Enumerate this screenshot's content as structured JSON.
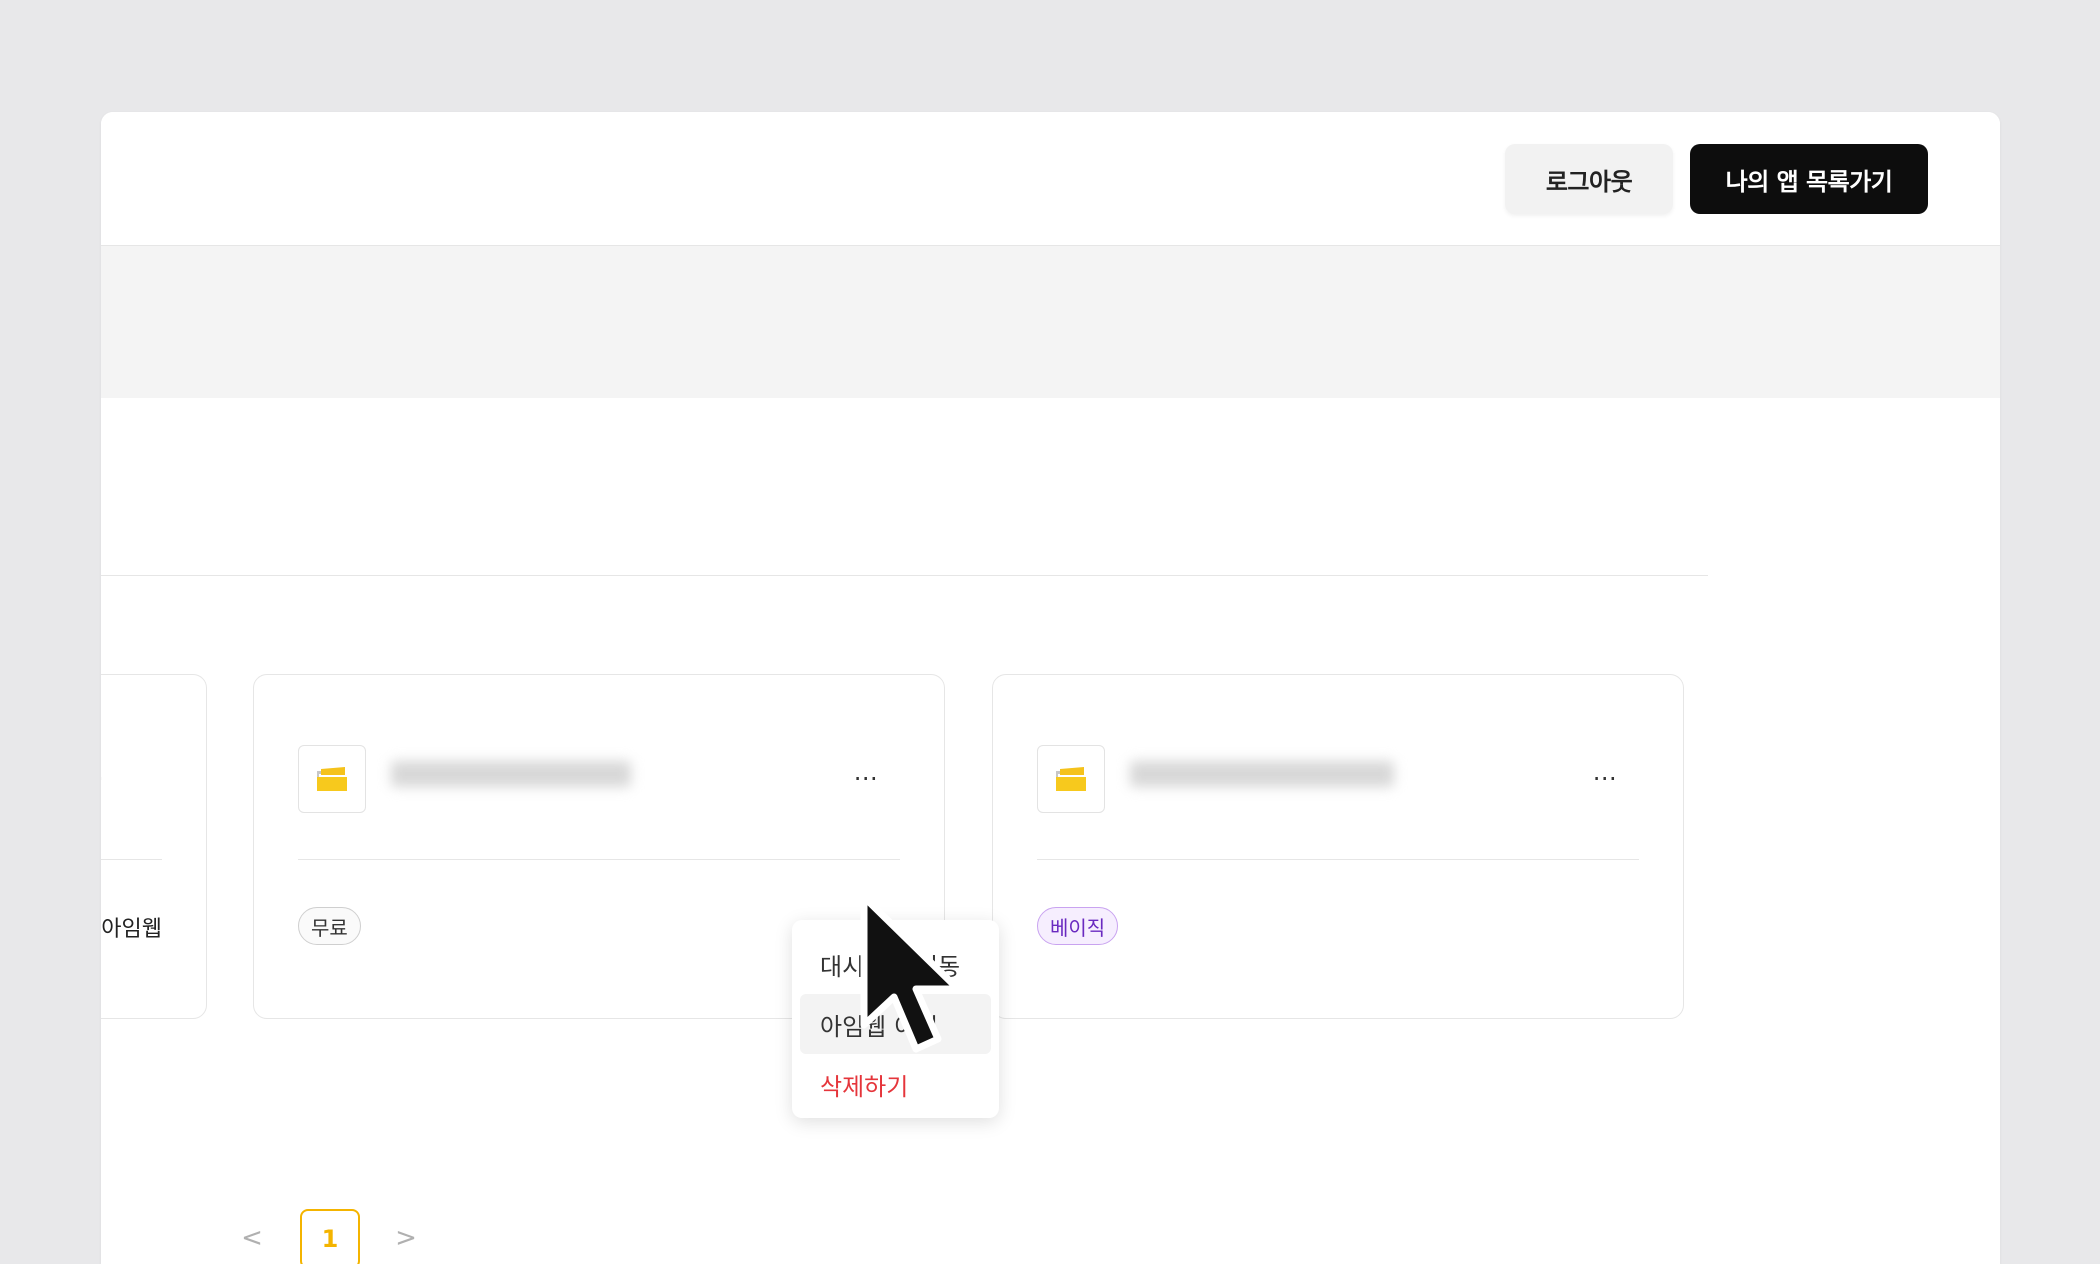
{
  "header": {
    "logout_label": "로그아웃",
    "my_apps_label": "나의 앱 목록가기"
  },
  "cards": [
    {
      "name": "",
      "tag": "아임웹"
    },
    {
      "name": "",
      "badge": "무료"
    },
    {
      "name": "",
      "badge": "베이직"
    }
  ],
  "context_menu": {
    "items": [
      "대시보드 이동",
      "아임웹 이전",
      "삭제하기"
    ]
  },
  "pagination": {
    "prev": "<",
    "current": "1",
    "next": ">"
  },
  "colors": {
    "accent": "#f4b400",
    "danger": "#e5353b",
    "primary_button": "#0d0d0d",
    "basic_badge": "#6a2ac0"
  }
}
